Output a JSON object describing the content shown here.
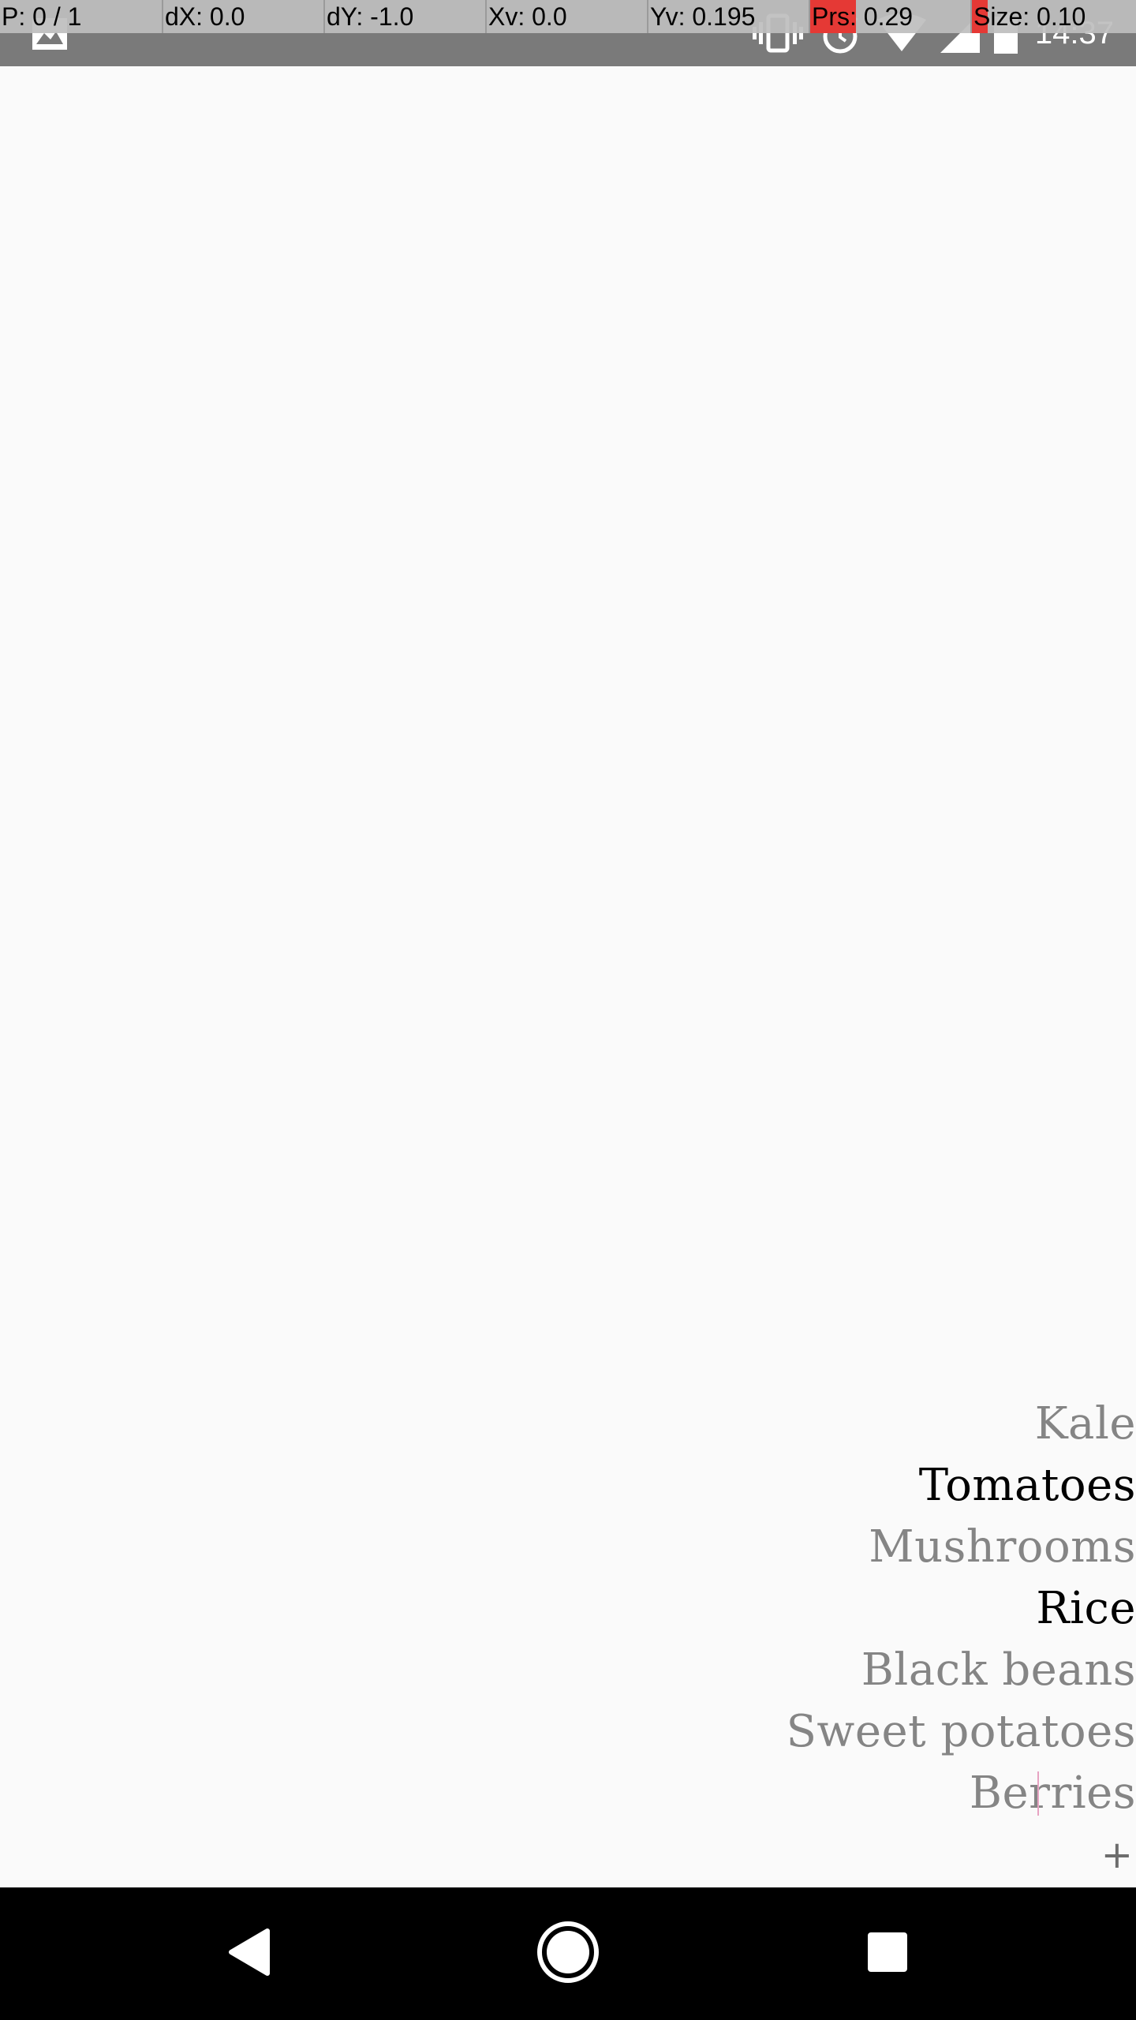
{
  "status_bar": {
    "time": "14:37",
    "icons": [
      "gallery-icon",
      "vibrate-icon",
      "alarm-icon",
      "wifi-icon",
      "signal-icon",
      "battery-icon"
    ]
  },
  "debug_overlay": {
    "cells": [
      {
        "text": "P: 0 / 1",
        "highlight": false
      },
      {
        "text": "dX: 0.0",
        "highlight": false
      },
      {
        "text": "dY: -1.0",
        "highlight": false
      },
      {
        "text": "Xv: 0.0",
        "highlight": false
      },
      {
        "text": "Yv: 0.195",
        "highlight": false
      },
      {
        "text": "Prs: 0.29",
        "highlight": true
      },
      {
        "text": "Size: 0.10",
        "highlight": true
      }
    ]
  },
  "list": {
    "items": [
      {
        "label": "Kale",
        "active": false
      },
      {
        "label": "Tomatoes",
        "active": true
      },
      {
        "label": "Mushrooms",
        "active": false
      },
      {
        "label": "Rice",
        "active": true
      },
      {
        "label": "Black beans",
        "active": false
      },
      {
        "label": "Sweet potatoes",
        "active": false
      },
      {
        "label": "Berries",
        "active": false
      }
    ],
    "add_label": "+"
  },
  "nav_bar": {
    "buttons": [
      "back-icon",
      "home-icon",
      "recents-icon"
    ]
  },
  "colors": {
    "background": "#fafafa",
    "active_text": "#000000",
    "inactive_text": "#858585",
    "status_bar": "#7a7a7a",
    "nav_bar": "#000000",
    "highlight": "#e53935"
  }
}
